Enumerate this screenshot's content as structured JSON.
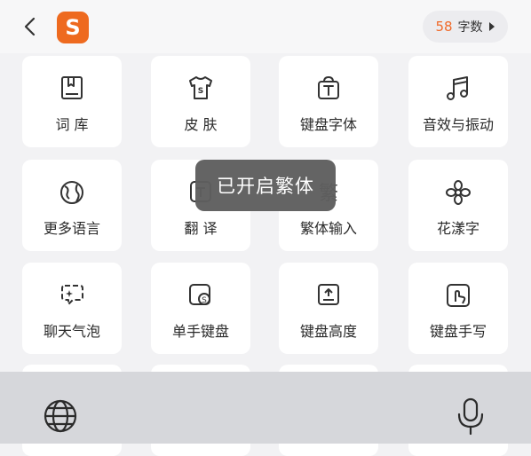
{
  "header": {
    "title": "",
    "word_count": {
      "value": "58",
      "label": "字数"
    }
  },
  "colors": {
    "accent": "#f06a2a",
    "logo": "#ee6a1f",
    "card": "#ffffff",
    "bg": "#f2f2f4"
  },
  "grid": {
    "items": [
      {
        "label": "词 库",
        "icon": "dictionary-icon"
      },
      {
        "label": "皮 肤",
        "icon": "tshirt-icon"
      },
      {
        "label": "键盘字体",
        "icon": "font-bag-icon"
      },
      {
        "label": "音效与振动",
        "icon": "music-note-icon"
      },
      {
        "label": "更多语言",
        "icon": "globe-icon"
      },
      {
        "label": "翻 译",
        "icon": "translate-icon"
      },
      {
        "label": "繁体输入",
        "icon": "traditional-char-icon"
      },
      {
        "label": "花漾字",
        "icon": "flower-icon"
      },
      {
        "label": "聊天气泡",
        "icon": "chat-bubble-icon"
      },
      {
        "label": "单手键盘",
        "icon": "one-hand-keyboard-icon"
      },
      {
        "label": "键盘高度",
        "icon": "keyboard-height-icon"
      },
      {
        "label": "键盘手写",
        "icon": "handwriting-icon"
      }
    ]
  },
  "toast": {
    "text": "已开启繁体"
  }
}
